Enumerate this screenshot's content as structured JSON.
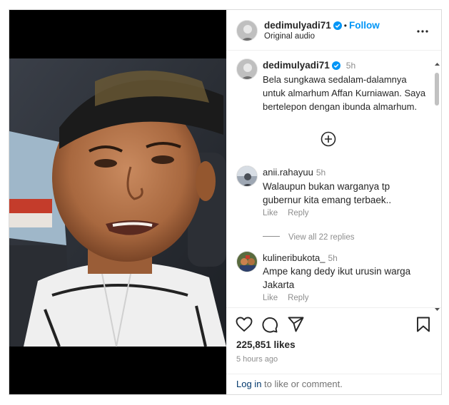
{
  "post": {
    "username": "dedimulyadi71",
    "follow_label": "Follow",
    "audio": "Original audio",
    "caption_time": "5h",
    "caption": "Bela sungkawa sedalam-dalamnya untuk almarhum Affan Kurniawan. Saya bertelepon dengan ibunda almarhum."
  },
  "comments": [
    {
      "username": "anii.rahayuu",
      "time": "5h",
      "text": "Walaupun bukan warganya tp gubernur kita emang terbaek..",
      "like_label": "Like",
      "reply_label": "Reply",
      "view_replies": "View all 22 replies"
    },
    {
      "username": "kulineribukota_",
      "time": "5h",
      "text": "Ampe kang dedy ikut urusin warga Jakarta",
      "like_label": "Like",
      "reply_label": "Reply"
    }
  ],
  "footer": {
    "likes": "225,851 likes",
    "posted_ago": "5 hours ago",
    "login_link": "Log in",
    "login_rest": " to like or comment."
  },
  "icons": {
    "heart": "heart-icon",
    "comment": "comment-icon",
    "share": "paper-plane-icon",
    "save": "bookmark-icon",
    "more": "more-dots-icon",
    "verified": "verified-badge-icon",
    "load_more": "plus-circle-icon"
  },
  "colors": {
    "accent": "#0095f6",
    "verified": "#0095f6",
    "muted": "#8e8e8e",
    "text": "#262626"
  }
}
